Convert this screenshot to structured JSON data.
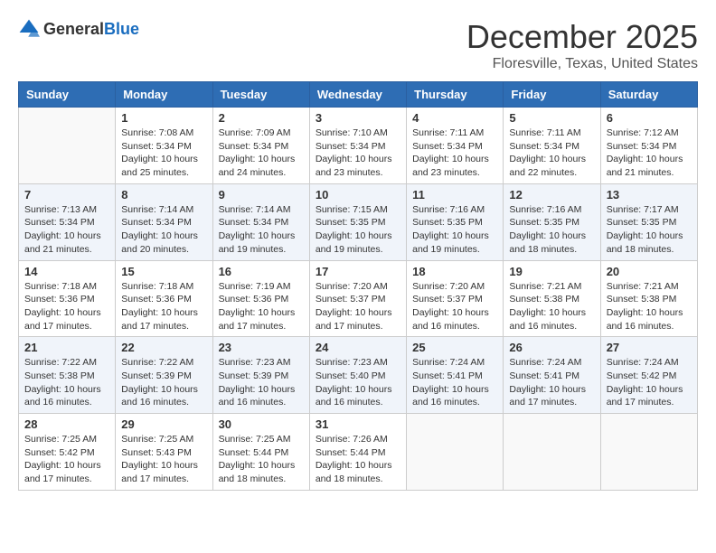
{
  "header": {
    "logo_general": "General",
    "logo_blue": "Blue",
    "month": "December 2025",
    "location": "Floresville, Texas, United States"
  },
  "weekdays": [
    "Sunday",
    "Monday",
    "Tuesday",
    "Wednesday",
    "Thursday",
    "Friday",
    "Saturday"
  ],
  "weeks": [
    [
      {
        "day": "",
        "info": ""
      },
      {
        "day": "1",
        "info": "Sunrise: 7:08 AM\nSunset: 5:34 PM\nDaylight: 10 hours\nand 25 minutes."
      },
      {
        "day": "2",
        "info": "Sunrise: 7:09 AM\nSunset: 5:34 PM\nDaylight: 10 hours\nand 24 minutes."
      },
      {
        "day": "3",
        "info": "Sunrise: 7:10 AM\nSunset: 5:34 PM\nDaylight: 10 hours\nand 23 minutes."
      },
      {
        "day": "4",
        "info": "Sunrise: 7:11 AM\nSunset: 5:34 PM\nDaylight: 10 hours\nand 23 minutes."
      },
      {
        "day": "5",
        "info": "Sunrise: 7:11 AM\nSunset: 5:34 PM\nDaylight: 10 hours\nand 22 minutes."
      },
      {
        "day": "6",
        "info": "Sunrise: 7:12 AM\nSunset: 5:34 PM\nDaylight: 10 hours\nand 21 minutes."
      }
    ],
    [
      {
        "day": "7",
        "info": "Sunrise: 7:13 AM\nSunset: 5:34 PM\nDaylight: 10 hours\nand 21 minutes."
      },
      {
        "day": "8",
        "info": "Sunrise: 7:14 AM\nSunset: 5:34 PM\nDaylight: 10 hours\nand 20 minutes."
      },
      {
        "day": "9",
        "info": "Sunrise: 7:14 AM\nSunset: 5:34 PM\nDaylight: 10 hours\nand 19 minutes."
      },
      {
        "day": "10",
        "info": "Sunrise: 7:15 AM\nSunset: 5:35 PM\nDaylight: 10 hours\nand 19 minutes."
      },
      {
        "day": "11",
        "info": "Sunrise: 7:16 AM\nSunset: 5:35 PM\nDaylight: 10 hours\nand 19 minutes."
      },
      {
        "day": "12",
        "info": "Sunrise: 7:16 AM\nSunset: 5:35 PM\nDaylight: 10 hours\nand 18 minutes."
      },
      {
        "day": "13",
        "info": "Sunrise: 7:17 AM\nSunset: 5:35 PM\nDaylight: 10 hours\nand 18 minutes."
      }
    ],
    [
      {
        "day": "14",
        "info": "Sunrise: 7:18 AM\nSunset: 5:36 PM\nDaylight: 10 hours\nand 17 minutes."
      },
      {
        "day": "15",
        "info": "Sunrise: 7:18 AM\nSunset: 5:36 PM\nDaylight: 10 hours\nand 17 minutes."
      },
      {
        "day": "16",
        "info": "Sunrise: 7:19 AM\nSunset: 5:36 PM\nDaylight: 10 hours\nand 17 minutes."
      },
      {
        "day": "17",
        "info": "Sunrise: 7:20 AM\nSunset: 5:37 PM\nDaylight: 10 hours\nand 17 minutes."
      },
      {
        "day": "18",
        "info": "Sunrise: 7:20 AM\nSunset: 5:37 PM\nDaylight: 10 hours\nand 16 minutes."
      },
      {
        "day": "19",
        "info": "Sunrise: 7:21 AM\nSunset: 5:38 PM\nDaylight: 10 hours\nand 16 minutes."
      },
      {
        "day": "20",
        "info": "Sunrise: 7:21 AM\nSunset: 5:38 PM\nDaylight: 10 hours\nand 16 minutes."
      }
    ],
    [
      {
        "day": "21",
        "info": "Sunrise: 7:22 AM\nSunset: 5:38 PM\nDaylight: 10 hours\nand 16 minutes."
      },
      {
        "day": "22",
        "info": "Sunrise: 7:22 AM\nSunset: 5:39 PM\nDaylight: 10 hours\nand 16 minutes."
      },
      {
        "day": "23",
        "info": "Sunrise: 7:23 AM\nSunset: 5:39 PM\nDaylight: 10 hours\nand 16 minutes."
      },
      {
        "day": "24",
        "info": "Sunrise: 7:23 AM\nSunset: 5:40 PM\nDaylight: 10 hours\nand 16 minutes."
      },
      {
        "day": "25",
        "info": "Sunrise: 7:24 AM\nSunset: 5:41 PM\nDaylight: 10 hours\nand 16 minutes."
      },
      {
        "day": "26",
        "info": "Sunrise: 7:24 AM\nSunset: 5:41 PM\nDaylight: 10 hours\nand 17 minutes."
      },
      {
        "day": "27",
        "info": "Sunrise: 7:24 AM\nSunset: 5:42 PM\nDaylight: 10 hours\nand 17 minutes."
      }
    ],
    [
      {
        "day": "28",
        "info": "Sunrise: 7:25 AM\nSunset: 5:42 PM\nDaylight: 10 hours\nand 17 minutes."
      },
      {
        "day": "29",
        "info": "Sunrise: 7:25 AM\nSunset: 5:43 PM\nDaylight: 10 hours\nand 17 minutes."
      },
      {
        "day": "30",
        "info": "Sunrise: 7:25 AM\nSunset: 5:44 PM\nDaylight: 10 hours\nand 18 minutes."
      },
      {
        "day": "31",
        "info": "Sunrise: 7:26 AM\nSunset: 5:44 PM\nDaylight: 10 hours\nand 18 minutes."
      },
      {
        "day": "",
        "info": ""
      },
      {
        "day": "",
        "info": ""
      },
      {
        "day": "",
        "info": ""
      }
    ]
  ],
  "colors": {
    "header_bg": "#2e6db4",
    "shaded_row": "#f0f4fa"
  }
}
